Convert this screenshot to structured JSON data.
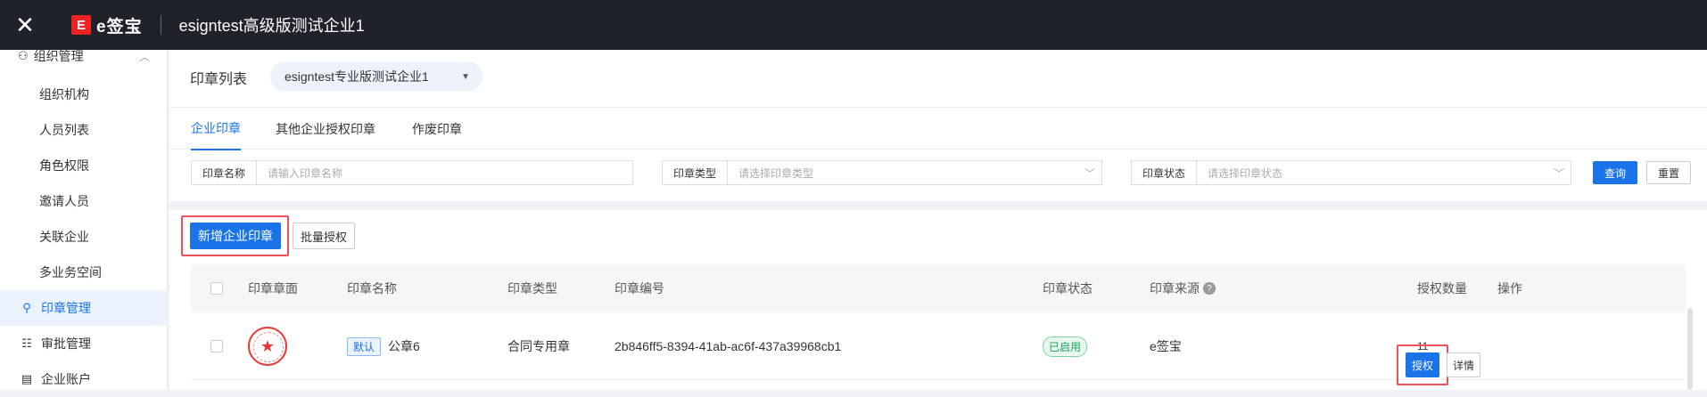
{
  "topbar": {
    "close_icon": "close-icon",
    "logo_mark": "E",
    "logo_text": "e签宝",
    "title": "esigntest高级版测试企业1"
  },
  "sidebar": {
    "group_label": "组织管理",
    "items": [
      {
        "label": "组织机构"
      },
      {
        "label": "人员列表"
      },
      {
        "label": "角色权限"
      },
      {
        "label": "邀请人员"
      },
      {
        "label": "关联企业"
      },
      {
        "label": "多业务空间"
      },
      {
        "label": "印章管理",
        "icon": "seal-icon",
        "active": true
      },
      {
        "label": "审批管理",
        "icon": "approval-icon"
      },
      {
        "label": "企业账户",
        "icon": "account-icon"
      }
    ]
  },
  "header": {
    "page_title": "印章列表",
    "company_select": "esigntest专业版测试企业1"
  },
  "tabs": [
    {
      "label": "企业印章",
      "active": true
    },
    {
      "label": "其他企业授权印章"
    },
    {
      "label": "作废印章"
    }
  ],
  "filters": {
    "name": {
      "label": "印章名称",
      "placeholder": "请输入印章名称"
    },
    "type": {
      "label": "印章类型",
      "placeholder": "请选择印章类型"
    },
    "status": {
      "label": "印章状态",
      "placeholder": "请选择印章状态"
    },
    "query_label": "查询",
    "reset_label": "重置"
  },
  "actions": {
    "add_label": "新增企业印章",
    "batch_label": "批量授权"
  },
  "table": {
    "headers": {
      "face": "印章章面",
      "name": "印章名称",
      "type": "印章类型",
      "code": "印章编号",
      "status": "印章状态",
      "source": "印章来源",
      "count": "授权数量",
      "ops": "操作"
    },
    "rows": [
      {
        "default_tag": "默认",
        "name": "公章6",
        "type": "合同专用章",
        "code": "2b846ff5-8394-41ab-ac6f-437a39968cb1",
        "status": "已启用",
        "source": "e签宝",
        "count": "11",
        "auth_label": "授权",
        "detail_label": "详情"
      }
    ]
  },
  "colors": {
    "accent": "#1a73e8",
    "highlight": "#f0505a",
    "topbar": "#1f2329"
  }
}
